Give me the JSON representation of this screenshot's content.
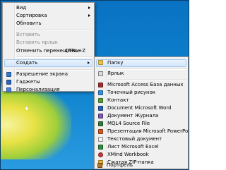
{
  "desktop": {
    "background_colors": {
      "top": "#0a72c2",
      "bottom": "#2a9be0",
      "glow": "#e8e245"
    }
  },
  "context_menu": {
    "items": [
      {
        "label": "Вид",
        "submenu": true,
        "disabled": false
      },
      {
        "label": "Сортировка",
        "submenu": true,
        "disabled": false
      },
      {
        "label": "Обновить",
        "submenu": false,
        "disabled": false
      },
      {
        "label": "Вставить",
        "submenu": false,
        "disabled": true
      },
      {
        "label": "Вставить ярлык",
        "submenu": false,
        "disabled": true
      },
      {
        "label": "Отменить перемещение",
        "shortcut": "CTRL+Z",
        "submenu": false,
        "disabled": false
      },
      {
        "label": "Создать",
        "submenu": true,
        "disabled": false,
        "highlighted": true
      },
      {
        "label": "Разрешение экрана",
        "icon": "screen-resolution-icon",
        "icon_color": "#3a78c8"
      },
      {
        "label": "Гаджеты",
        "icon": "gadgets-icon",
        "icon_color": "#2f63b8"
      },
      {
        "label": "Персонализация",
        "icon": "personalization-icon",
        "icon_color": "#4a7fd0"
      }
    ]
  },
  "new_submenu": {
    "items": [
      {
        "label": "Папку",
        "icon": "folder-icon",
        "icon_color": "#e8c25a"
      },
      {
        "label": "Ярлык",
        "icon": "shortcut-icon",
        "icon_color": "#dcdcdc"
      },
      {
        "label": "Microsoft Access База данных",
        "icon": "access-icon",
        "icon_color": "#a03030"
      },
      {
        "label": "Точечный рисунок",
        "icon": "bitmap-icon",
        "icon_color": "#3c8dd8"
      },
      {
        "label": "Контакт",
        "icon": "contact-icon",
        "icon_color": "#5a9a3a"
      },
      {
        "label": "Document Microsoft Word",
        "icon": "word-icon",
        "icon_color": "#2b5fb0"
      },
      {
        "label": "Документ Журнала",
        "icon": "journal-icon",
        "icon_color": "#7a5aa8"
      },
      {
        "label": "MQL4 Source File",
        "icon": "mql4-icon",
        "icon_color": "#3a7a3a"
      },
      {
        "label": "Презентация Microsoft PowerPoint",
        "icon": "powerpoint-icon",
        "icon_color": "#d05a20"
      },
      {
        "label": "Текстовый документ",
        "icon": "text-document-icon",
        "icon_color": "#f4f4f4"
      },
      {
        "label": "Лист Microsoft Excel",
        "icon": "excel-icon",
        "icon_color": "#2f8a3a"
      },
      {
        "label": "XMind Workbook",
        "icon": "xmind-icon",
        "icon_color": "#c83a3a"
      },
      {
        "label": "Сжатая ZIP-папка",
        "icon": "zip-folder-icon",
        "icon_color": "#e0b640"
      },
      {
        "label": "Портфель",
        "icon": "briefcase-icon",
        "icon_color": "#b0782a"
      }
    ]
  }
}
